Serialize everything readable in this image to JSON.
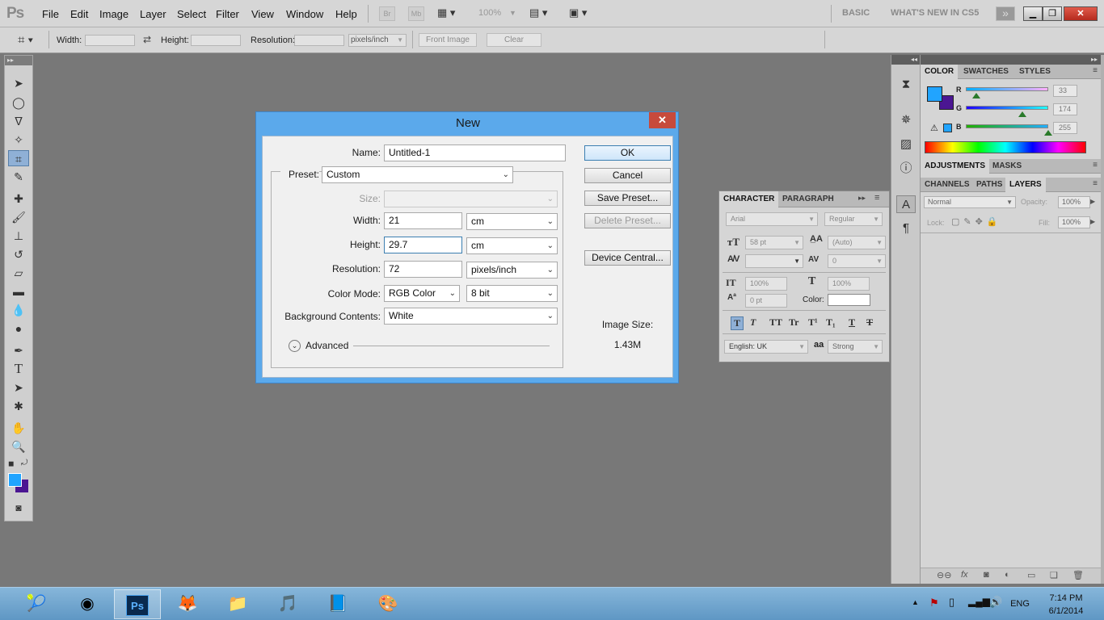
{
  "menubar": {
    "logo": "Ps",
    "items": [
      "File",
      "Edit",
      "Image",
      "Layer",
      "Select",
      "Filter",
      "View",
      "Window",
      "Help"
    ],
    "bridge_label": "Br",
    "minibridge_label": "Mb",
    "zoom": "100%",
    "workspaces": [
      "BASIC",
      "WHAT'S NEW IN CS5"
    ]
  },
  "options_bar": {
    "width_label": "Width:",
    "height_label": "Height:",
    "resolution_label": "Resolution:",
    "units": "pixels/inch",
    "front_image": "Front Image",
    "clear": "Clear"
  },
  "color_panel": {
    "tabs": [
      "COLOR",
      "SWATCHES",
      "STYLES"
    ],
    "foreground": "#21a4ff",
    "background": "#4b1692",
    "r_label": "R",
    "g_label": "G",
    "b_label": "B",
    "r_value": "33",
    "g_value": "174",
    "b_value": "255",
    "r_fraction": 0.129,
    "g_fraction": 0.682,
    "b_fraction": 1.0
  },
  "adjustments_tabs": [
    "ADJUSTMENTS",
    "MASKS"
  ],
  "layers_panel": {
    "tabs": [
      "CHANNELS",
      "PATHS",
      "LAYERS"
    ],
    "blend_mode": "Normal",
    "opacity_label": "Opacity:",
    "opacity_value": "100%",
    "lock_label": "Lock:",
    "fill_label": "Fill:",
    "fill_value": "100%"
  },
  "character_panel": {
    "tabs": [
      "CHARACTER",
      "PARAGRAPH"
    ],
    "font_family": "Arial",
    "font_style": "Regular",
    "font_size": "58 pt",
    "leading": "(Auto)",
    "kerning": "",
    "tracking": "0",
    "vertical_scale": "100%",
    "horizontal_scale": "100%",
    "baseline_shift": "0 pt",
    "color_label": "Color:",
    "language": "English: UK",
    "antialias_label": "aa",
    "antialias": "Strong",
    "styles": [
      "T",
      "T",
      "TT",
      "Tr",
      "T¹",
      "T₁",
      "T",
      "T"
    ]
  },
  "dialog": {
    "title": "New",
    "name_label": "Name:",
    "name_value": "Untitled-1",
    "preset_label": "Preset:",
    "preset_value": "Custom",
    "size_label": "Size:",
    "size_value": "",
    "width_label": "Width:",
    "width_value": "21",
    "width_unit": "cm",
    "height_label": "Height:",
    "height_value": "29.7",
    "height_unit": "cm",
    "resolution_label": "Resolution:",
    "resolution_value": "72",
    "resolution_unit": "pixels/inch",
    "color_mode_label": "Color Mode:",
    "color_mode_value": "RGB Color",
    "bit_depth": "8 bit",
    "background_label": "Background Contents:",
    "background_value": "White",
    "advanced_label": "Advanced",
    "ok": "OK",
    "cancel": "Cancel",
    "save_preset": "Save Preset...",
    "delete_preset": "Delete Preset...",
    "device_central": "Device Central...",
    "image_size_label": "Image Size:",
    "image_size_value": "1.43M"
  },
  "taskbar": {
    "language": "ENG",
    "time": "7:14 PM",
    "date": "6/1/2014"
  }
}
